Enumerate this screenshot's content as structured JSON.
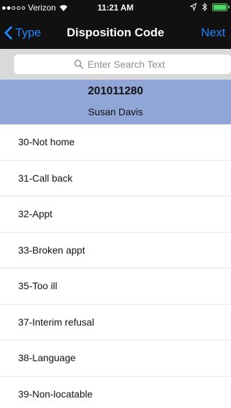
{
  "status_bar": {
    "carrier": "Verizon",
    "time": "11:21 AM"
  },
  "nav": {
    "back_label": "Type",
    "title": "Disposition Code",
    "next_label": "Next"
  },
  "search": {
    "placeholder": "Enter Search Text"
  },
  "header": {
    "case_id": "201011280",
    "person_name": "Susan Davis"
  },
  "codes": [
    {
      "label": "30-Not home"
    },
    {
      "label": "31-Call back"
    },
    {
      "label": "32-Appt"
    },
    {
      "label": "33-Broken appt"
    },
    {
      "label": "35-Too ill"
    },
    {
      "label": "37-Interim refusal"
    },
    {
      "label": "38-Language"
    },
    {
      "label": "39-Non-locatable"
    }
  ],
  "colors": {
    "accent": "#1e88ff",
    "header_bg": "#8fa6d6",
    "topbar_bg": "#111111",
    "battery": "#4cd964"
  }
}
